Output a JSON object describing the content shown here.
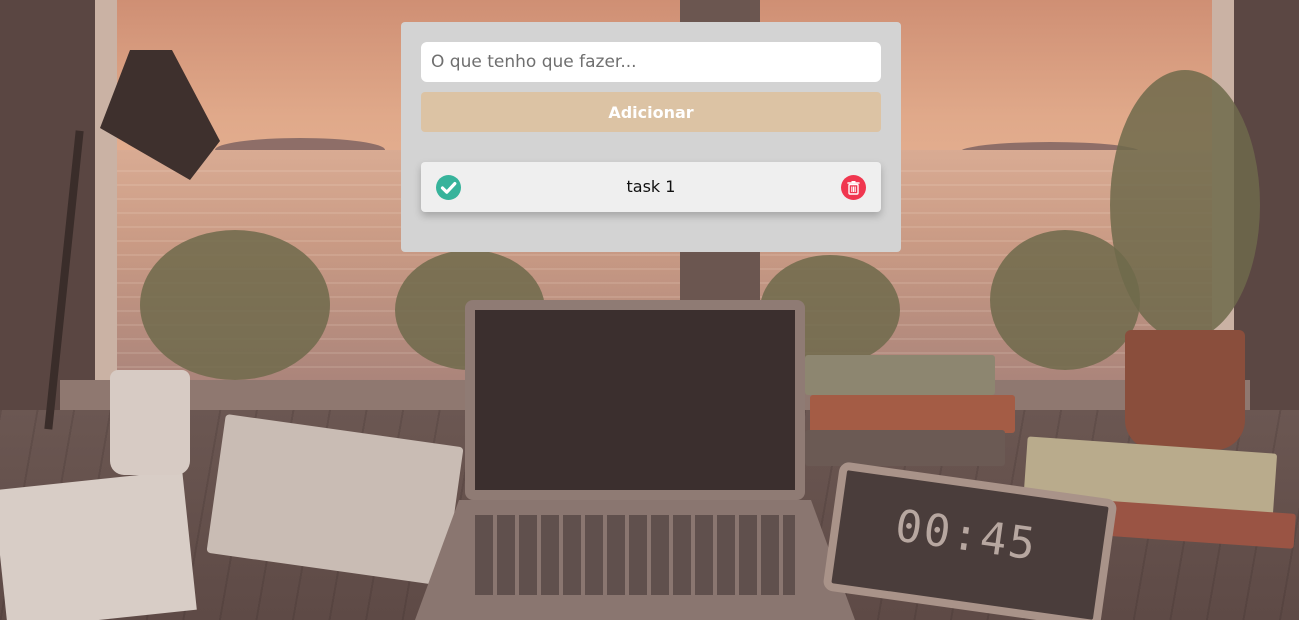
{
  "new_task": {
    "placeholder": "O que tenho que fazer...",
    "value": ""
  },
  "add_button": {
    "label": "Adicionar"
  },
  "tasks": [
    {
      "label": "task 1",
      "icon_left": "check-circle-icon",
      "icon_right": "trash-icon"
    }
  ],
  "background": {
    "timer_display": "00:45"
  },
  "colors": {
    "card_bg": "#d3d3d3",
    "button_bg": "#dcc3a4",
    "check_green": "#37b39b",
    "delete_red": "#f0364f"
  }
}
